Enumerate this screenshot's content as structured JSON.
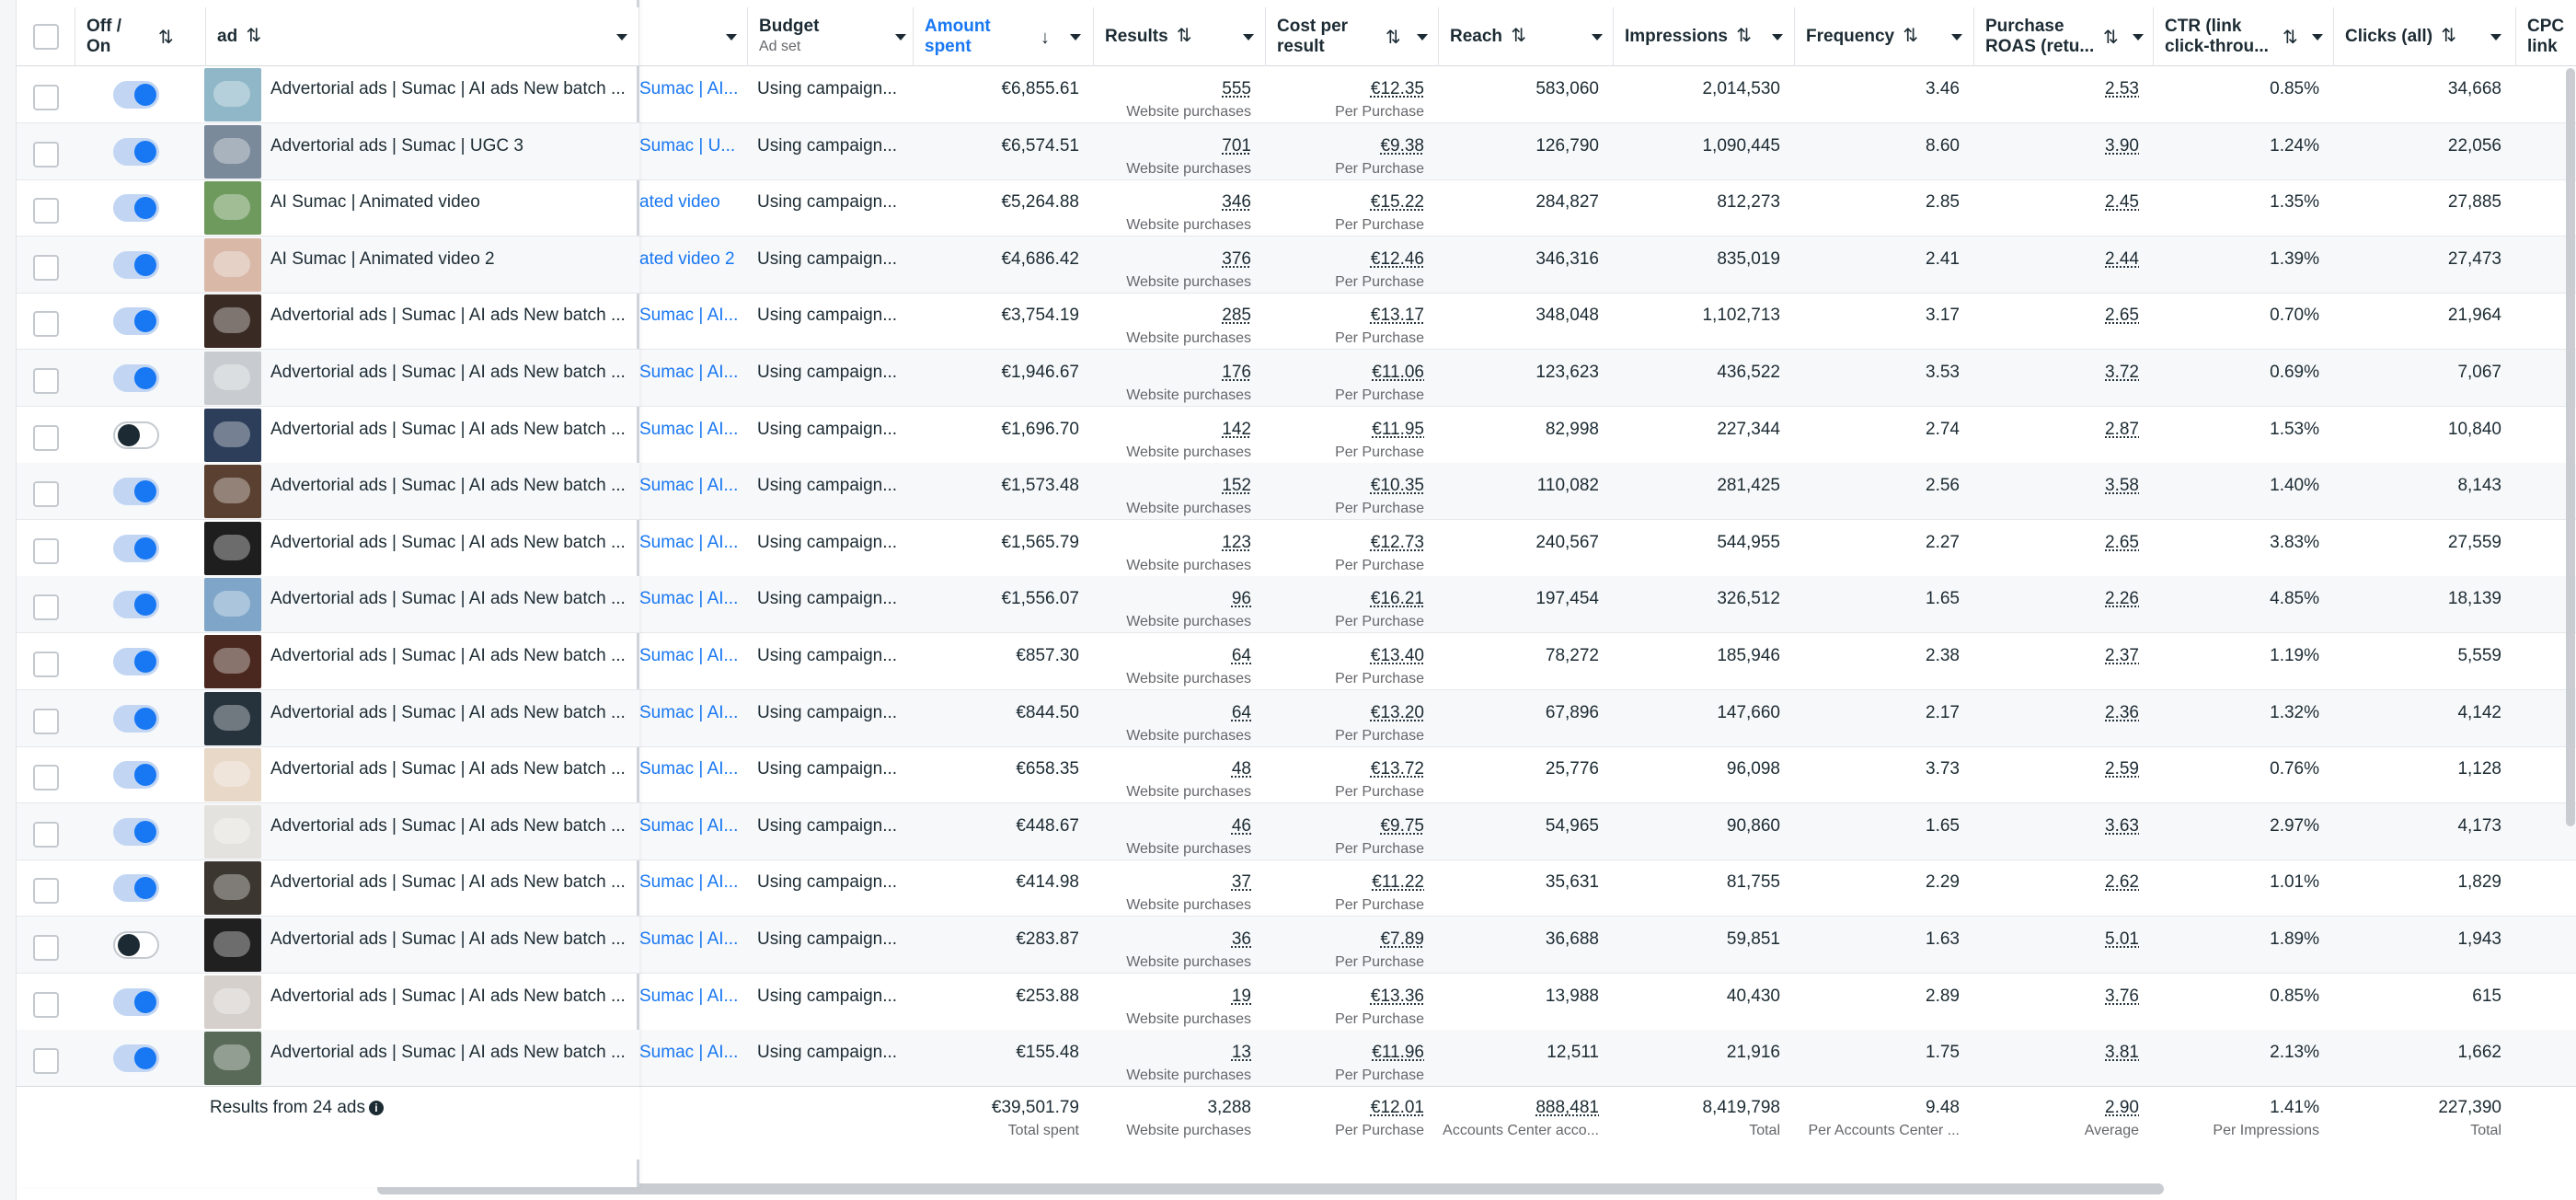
{
  "headers": {
    "toggle": "Off /\nOn",
    "ad": "ad",
    "budget": "Budget",
    "budget_sub": "Ad set",
    "amount": "Amount\nspent",
    "results": "Results",
    "cpr": "Cost per\nresult",
    "reach": "Reach",
    "impressions": "Impressions",
    "frequency": "Frequency",
    "roas": "Purchase\nROAS (retu...",
    "ctr": "CTR (link\nclick-throu...",
    "clicks": "Clicks (all)",
    "cpc": "CPC\nlink"
  },
  "icons": {
    "sort": "sort-arrows-icon",
    "sort_desc": "arrow-down-icon",
    "dropdown": "caret-down-icon",
    "info": "info-icon"
  },
  "colors": {
    "accent": "#1877f2",
    "toggle_on_track": "#c2d6f3",
    "row_alt": "#f7f8fa"
  },
  "rows": [
    {
      "on": true,
      "thumb": "#8fb7c8",
      "name": "Advertorial ads | Sumac | AI ads New batch ...",
      "campaign": "Sumac | AI...",
      "budget": "Using campaign...",
      "amount": "€6,855.61",
      "results": "555",
      "results_sub": "Website purchases",
      "cpr": "€12.35",
      "cpr_sub": "Per Purchase",
      "reach": "583,060",
      "impressions": "2,014,530",
      "frequency": "3.46",
      "roas": "2.53",
      "ctr": "0.85%",
      "clicks": "34,668"
    },
    {
      "on": true,
      "thumb": "#7a8a9a",
      "name": "Advertorial ads | Sumac | UGC 3",
      "campaign": "Sumac | U...",
      "budget": "Using campaign...",
      "amount": "€6,574.51",
      "results": "701",
      "results_sub": "Website purchases",
      "cpr": "€9.38",
      "cpr_sub": "Per Purchase",
      "reach": "126,790",
      "impressions": "1,090,445",
      "frequency": "8.60",
      "roas": "3.90",
      "ctr": "1.24%",
      "clicks": "22,056"
    },
    {
      "on": true,
      "thumb": "#6f9a5e",
      "name": "AI Sumac | Animated video",
      "campaign": "ated video",
      "budget": "Using campaign...",
      "amount": "€5,264.88",
      "results": "346",
      "results_sub": "Website purchases",
      "cpr": "€15.22",
      "cpr_sub": "Per Purchase",
      "reach": "284,827",
      "impressions": "812,273",
      "frequency": "2.85",
      "roas": "2.45",
      "ctr": "1.35%",
      "clicks": "27,885"
    },
    {
      "on": true,
      "thumb": "#d9b8a8",
      "name": "AI Sumac | Animated video 2",
      "campaign": "ated video 2",
      "budget": "Using campaign...",
      "amount": "€4,686.42",
      "results": "376",
      "results_sub": "Website purchases",
      "cpr": "€12.46",
      "cpr_sub": "Per Purchase",
      "reach": "346,316",
      "impressions": "835,019",
      "frequency": "2.41",
      "roas": "2.44",
      "ctr": "1.39%",
      "clicks": "27,473"
    },
    {
      "on": true,
      "thumb": "#3a2a24",
      "name": "Advertorial ads | Sumac | AI ads New batch ...",
      "campaign": "Sumac | AI...",
      "budget": "Using campaign...",
      "amount": "€3,754.19",
      "results": "285",
      "results_sub": "Website purchases",
      "cpr": "€13.17",
      "cpr_sub": "Per Purchase",
      "reach": "348,048",
      "impressions": "1,102,713",
      "frequency": "3.17",
      "roas": "2.65",
      "ctr": "0.70%",
      "clicks": "21,964"
    },
    {
      "on": true,
      "thumb": "#c8ccd0",
      "name": "Advertorial ads | Sumac | AI ads New batch ...",
      "campaign": "Sumac | AI...",
      "budget": "Using campaign...",
      "amount": "€1,946.67",
      "results": "176",
      "results_sub": "Website purchases",
      "cpr": "€11.06",
      "cpr_sub": "Per Purchase",
      "reach": "123,623",
      "impressions": "436,522",
      "frequency": "3.53",
      "roas": "3.72",
      "ctr": "0.69%",
      "clicks": "7,067"
    },
    {
      "on": false,
      "thumb": "#2c3e5a",
      "name": "Advertorial ads | Sumac | AI ads New batch ...",
      "campaign": "Sumac | AI...",
      "budget": "Using campaign...",
      "amount": "€1,696.70",
      "results": "142",
      "results_sub": "Website purchases",
      "cpr": "€11.95",
      "cpr_sub": "Per Purchase",
      "reach": "82,998",
      "impressions": "227,344",
      "frequency": "2.74",
      "roas": "2.87",
      "ctr": "1.53%",
      "clicks": "10,840"
    },
    {
      "on": true,
      "thumb": "#5a4030",
      "name": "Advertorial ads | Sumac | AI ads New batch ...",
      "campaign": "Sumac | AI...",
      "budget": "Using campaign...",
      "amount": "€1,573.48",
      "results": "152",
      "results_sub": "Website purchases",
      "cpr": "€10.35",
      "cpr_sub": "Per Purchase",
      "reach": "110,082",
      "impressions": "281,425",
      "frequency": "2.56",
      "roas": "3.58",
      "ctr": "1.40%",
      "clicks": "8,143"
    },
    {
      "on": true,
      "thumb": "#1e1e1e",
      "name": "Advertorial ads | Sumac | AI ads New batch ...",
      "campaign": "Sumac | AI...",
      "budget": "Using campaign...",
      "amount": "€1,565.79",
      "results": "123",
      "results_sub": "Website purchases",
      "cpr": "€12.73",
      "cpr_sub": "Per Purchase",
      "reach": "240,567",
      "impressions": "544,955",
      "frequency": "2.27",
      "roas": "2.65",
      "ctr": "3.83%",
      "clicks": "27,559"
    },
    {
      "on": true,
      "thumb": "#7fa6c9",
      "name": "Advertorial ads | Sumac | AI ads New batch ...",
      "campaign": "Sumac | AI...",
      "budget": "Using campaign...",
      "amount": "€1,556.07",
      "results": "96",
      "results_sub": "Website purchases",
      "cpr": "€16.21",
      "cpr_sub": "Per Purchase",
      "reach": "197,454",
      "impressions": "326,512",
      "frequency": "1.65",
      "roas": "2.26",
      "ctr": "4.85%",
      "clicks": "18,139"
    },
    {
      "on": true,
      "thumb": "#4a2820",
      "name": "Advertorial ads | Sumac | AI ads New batch ...",
      "campaign": "Sumac | AI...",
      "budget": "Using campaign...",
      "amount": "€857.30",
      "results": "64",
      "results_sub": "Website purchases",
      "cpr": "€13.40",
      "cpr_sub": "Per Purchase",
      "reach": "78,272",
      "impressions": "185,946",
      "frequency": "2.38",
      "roas": "2.37",
      "ctr": "1.19%",
      "clicks": "5,559"
    },
    {
      "on": true,
      "thumb": "#26323c",
      "name": "Advertorial ads | Sumac | AI ads New batch ...",
      "campaign": "Sumac | AI...",
      "budget": "Using campaign...",
      "amount": "€844.50",
      "results": "64",
      "results_sub": "Website purchases",
      "cpr": "€13.20",
      "cpr_sub": "Per Purchase",
      "reach": "67,896",
      "impressions": "147,660",
      "frequency": "2.17",
      "roas": "2.36",
      "ctr": "1.32%",
      "clicks": "4,142"
    },
    {
      "on": true,
      "thumb": "#e8d8c8",
      "name": "Advertorial ads | Sumac | AI ads New batch ...",
      "campaign": "Sumac | AI...",
      "budget": "Using campaign...",
      "amount": "€658.35",
      "results": "48",
      "results_sub": "Website purchases",
      "cpr": "€13.72",
      "cpr_sub": "Per Purchase",
      "reach": "25,776",
      "impressions": "96,098",
      "frequency": "3.73",
      "roas": "2.59",
      "ctr": "0.76%",
      "clicks": "1,128"
    },
    {
      "on": true,
      "thumb": "#e4e2de",
      "name": "Advertorial ads | Sumac | AI ads New batch ...",
      "campaign": "Sumac | AI...",
      "budget": "Using campaign...",
      "amount": "€448.67",
      "results": "46",
      "results_sub": "Website purchases",
      "cpr": "€9.75",
      "cpr_sub": "Per Purchase",
      "reach": "54,965",
      "impressions": "90,860",
      "frequency": "1.65",
      "roas": "3.63",
      "ctr": "2.97%",
      "clicks": "4,173"
    },
    {
      "on": true,
      "thumb": "#3b3630",
      "name": "Advertorial ads | Sumac | AI ads New batch ...",
      "campaign": "Sumac | AI...",
      "budget": "Using campaign...",
      "amount": "€414.98",
      "results": "37",
      "results_sub": "Website purchases",
      "cpr": "€11.22",
      "cpr_sub": "Per Purchase",
      "reach": "35,631",
      "impressions": "81,755",
      "frequency": "2.29",
      "roas": "2.62",
      "ctr": "1.01%",
      "clicks": "1,829"
    },
    {
      "on": false,
      "thumb": "#202020",
      "name": "Advertorial ads | Sumac | AI ads New batch ...",
      "campaign": "Sumac | AI...",
      "budget": "Using campaign...",
      "amount": "€283.87",
      "results": "36",
      "results_sub": "Website purchases",
      "cpr": "€7.89",
      "cpr_sub": "Per Purchase",
      "reach": "36,688",
      "impressions": "59,851",
      "frequency": "1.63",
      "roas": "5.01",
      "ctr": "1.89%",
      "clicks": "1,943"
    },
    {
      "on": true,
      "thumb": "#d6d0cc",
      "name": "Advertorial ads | Sumac | AI ads New batch ...",
      "campaign": "Sumac | AI...",
      "budget": "Using campaign...",
      "amount": "€253.88",
      "results": "19",
      "results_sub": "Website purchases",
      "cpr": "€13.36",
      "cpr_sub": "Per Purchase",
      "reach": "13,988",
      "impressions": "40,430",
      "frequency": "2.89",
      "roas": "3.76",
      "ctr": "0.85%",
      "clicks": "615"
    },
    {
      "on": true,
      "thumb": "#5a6a58",
      "name": "Advertorial ads | Sumac | AI ads New batch ...",
      "campaign": "Sumac | AI...",
      "budget": "Using campaign...",
      "amount": "€155.48",
      "results": "13",
      "results_sub": "Website purchases",
      "cpr": "€11.96",
      "cpr_sub": "Per Purchase",
      "reach": "12,511",
      "impressions": "21,916",
      "frequency": "1.75",
      "roas": "3.81",
      "ctr": "2.13%",
      "clicks": "1,662"
    }
  ],
  "footer": {
    "label": "Results from 24 ads",
    "amount": "€39,501.79",
    "amount_sub": "Total spent",
    "results": "3,288",
    "results_sub": "Website purchases",
    "cpr": "€12.01",
    "cpr_sub": "Per Purchase",
    "reach": "888,481",
    "reach_sub": "Accounts Center acco...",
    "impressions": "8,419,798",
    "impressions_sub": "Total",
    "frequency": "9.48",
    "frequency_sub": "Per Accounts Center ...",
    "roas": "2.90",
    "roas_sub": "Average",
    "ctr": "1.41%",
    "ctr_sub": "Per Impressions",
    "clicks": "227,390",
    "clicks_sub": "Total"
  }
}
